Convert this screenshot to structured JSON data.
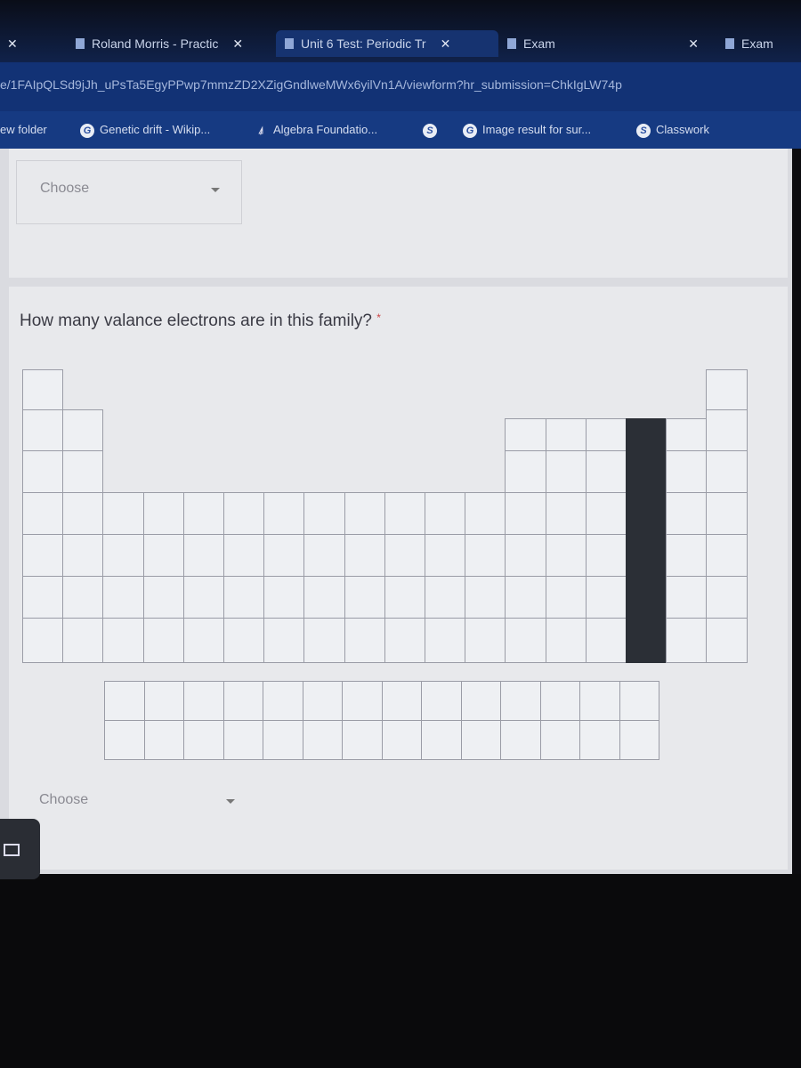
{
  "tabs": [
    {
      "label": "",
      "active": false
    },
    {
      "label": "Roland Morris - Practic",
      "active": false
    },
    {
      "label": "Unit 6 Test: Periodic Tr",
      "active": true
    },
    {
      "label": "Exam",
      "active": false
    },
    {
      "label": "Exam",
      "active": false
    }
  ],
  "url": "e/1FAIpQLSd9jJh_uPsTa5EgyPPwp7mmzZD2XZigGndlweMWx6yilVn1A/viewform?hr_submission=ChkIgLW74p",
  "bookmarks": [
    "ew folder",
    "Genetic drift - Wikip...",
    "Algebra Foundatio...",
    "",
    "Image result for sur...",
    "Classwork"
  ],
  "prev_question": {
    "select_placeholder": "Choose"
  },
  "question": {
    "text": "How many valance electrons are in this family?",
    "required_mark": "*",
    "select_placeholder": "Choose",
    "highlighted_group": 16
  },
  "colors": {
    "highlight": "#2b2f36",
    "bookmark_bar": "#163a82"
  }
}
